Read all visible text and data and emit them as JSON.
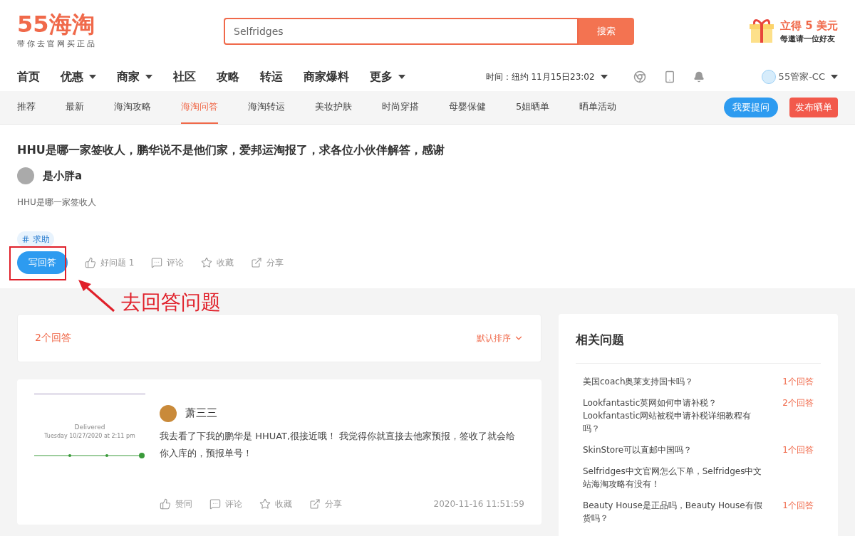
{
  "logo": {
    "mark": "55海淘",
    "slogan": "带你去官网买正品"
  },
  "search": {
    "value": "Selfridges",
    "button": "搜索"
  },
  "promo": {
    "title": "立得 5 美元",
    "subtitle": "每邀请一位好友"
  },
  "main_nav": [
    {
      "label": "首页",
      "dropdown": false
    },
    {
      "label": "优惠",
      "dropdown": true
    },
    {
      "label": "商家",
      "dropdown": true
    },
    {
      "label": "社区",
      "dropdown": false
    },
    {
      "label": "攻略",
      "dropdown": false
    },
    {
      "label": "转运",
      "dropdown": false
    },
    {
      "label": "商家爆料",
      "dropdown": false
    },
    {
      "label": "更多",
      "dropdown": true
    }
  ],
  "time": {
    "label": "时间：",
    "value": "纽约 11月15日23:02"
  },
  "user": {
    "name": "55管家-CC"
  },
  "sub_nav": [
    {
      "label": "推荐",
      "selected": false
    },
    {
      "label": "最新",
      "selected": false
    },
    {
      "label": "海淘攻略",
      "selected": false
    },
    {
      "label": "海淘问答",
      "selected": true
    },
    {
      "label": "海淘转运",
      "selected": false
    },
    {
      "label": "美妆护肤",
      "selected": false
    },
    {
      "label": "时尚穿搭",
      "selected": false
    },
    {
      "label": "母婴保健",
      "selected": false
    },
    {
      "label": "5姐晒单",
      "selected": false
    },
    {
      "label": "晒单活动",
      "selected": false
    }
  ],
  "sub_nav_buttons": {
    "ask": "我要提问",
    "post": "发布晒单"
  },
  "question": {
    "title": "HHU是哪一家签收人，鹏华说不是他们家，爱邦运淘报了，求各位小伙伴解答，感谢",
    "author": "是小胖a",
    "body": "HHU是哪一家签收人",
    "tag": "求助",
    "answer_button": "写回答",
    "actions": [
      {
        "kind": "like",
        "label": "好问题 1"
      },
      {
        "kind": "comment",
        "label": "评论"
      },
      {
        "kind": "star",
        "label": "收藏"
      },
      {
        "kind": "share",
        "label": "分享"
      }
    ]
  },
  "annotation": {
    "text": "去回答问题"
  },
  "answers_header": {
    "count": "2个回答",
    "sort": "默认排序"
  },
  "answers": [
    {
      "image_texts": {
        "status": "Delivered",
        "date": "Tuesday 10/27/2020 at 2:11 pm"
      },
      "author": "萧三三",
      "body": "我去看了下我的鹏华是 HHUAT,很接近哦！ 我觉得你就直接去他家预报，签收了就会给你入库的，预报单号！",
      "actions": [
        {
          "kind": "like",
          "label": "赞同"
        },
        {
          "kind": "comment",
          "label": "评论"
        },
        {
          "kind": "star",
          "label": "收藏"
        },
        {
          "kind": "share",
          "label": "分享"
        }
      ],
      "time": "2020-11-16 11:51:59"
    }
  ],
  "related": {
    "title": "相关问题",
    "items": [
      {
        "text": "美国coach奥莱支持国卡吗？",
        "count": "1个回答"
      },
      {
        "text": "Lookfantastic英网如何申请补税？Lookfantastic网站被税申请补税详细教程有吗？",
        "count": "2个回答"
      },
      {
        "text": "SkinStore可以直邮中国吗？",
        "count": "1个回答"
      },
      {
        "text": "Selfridges中文官网怎么下单，Selfridges中文站海淘攻略有没有！"
      },
      {
        "text": "Beauty House是正品吗，Beauty House有假货吗？",
        "count": "1个回答"
      }
    ]
  }
}
